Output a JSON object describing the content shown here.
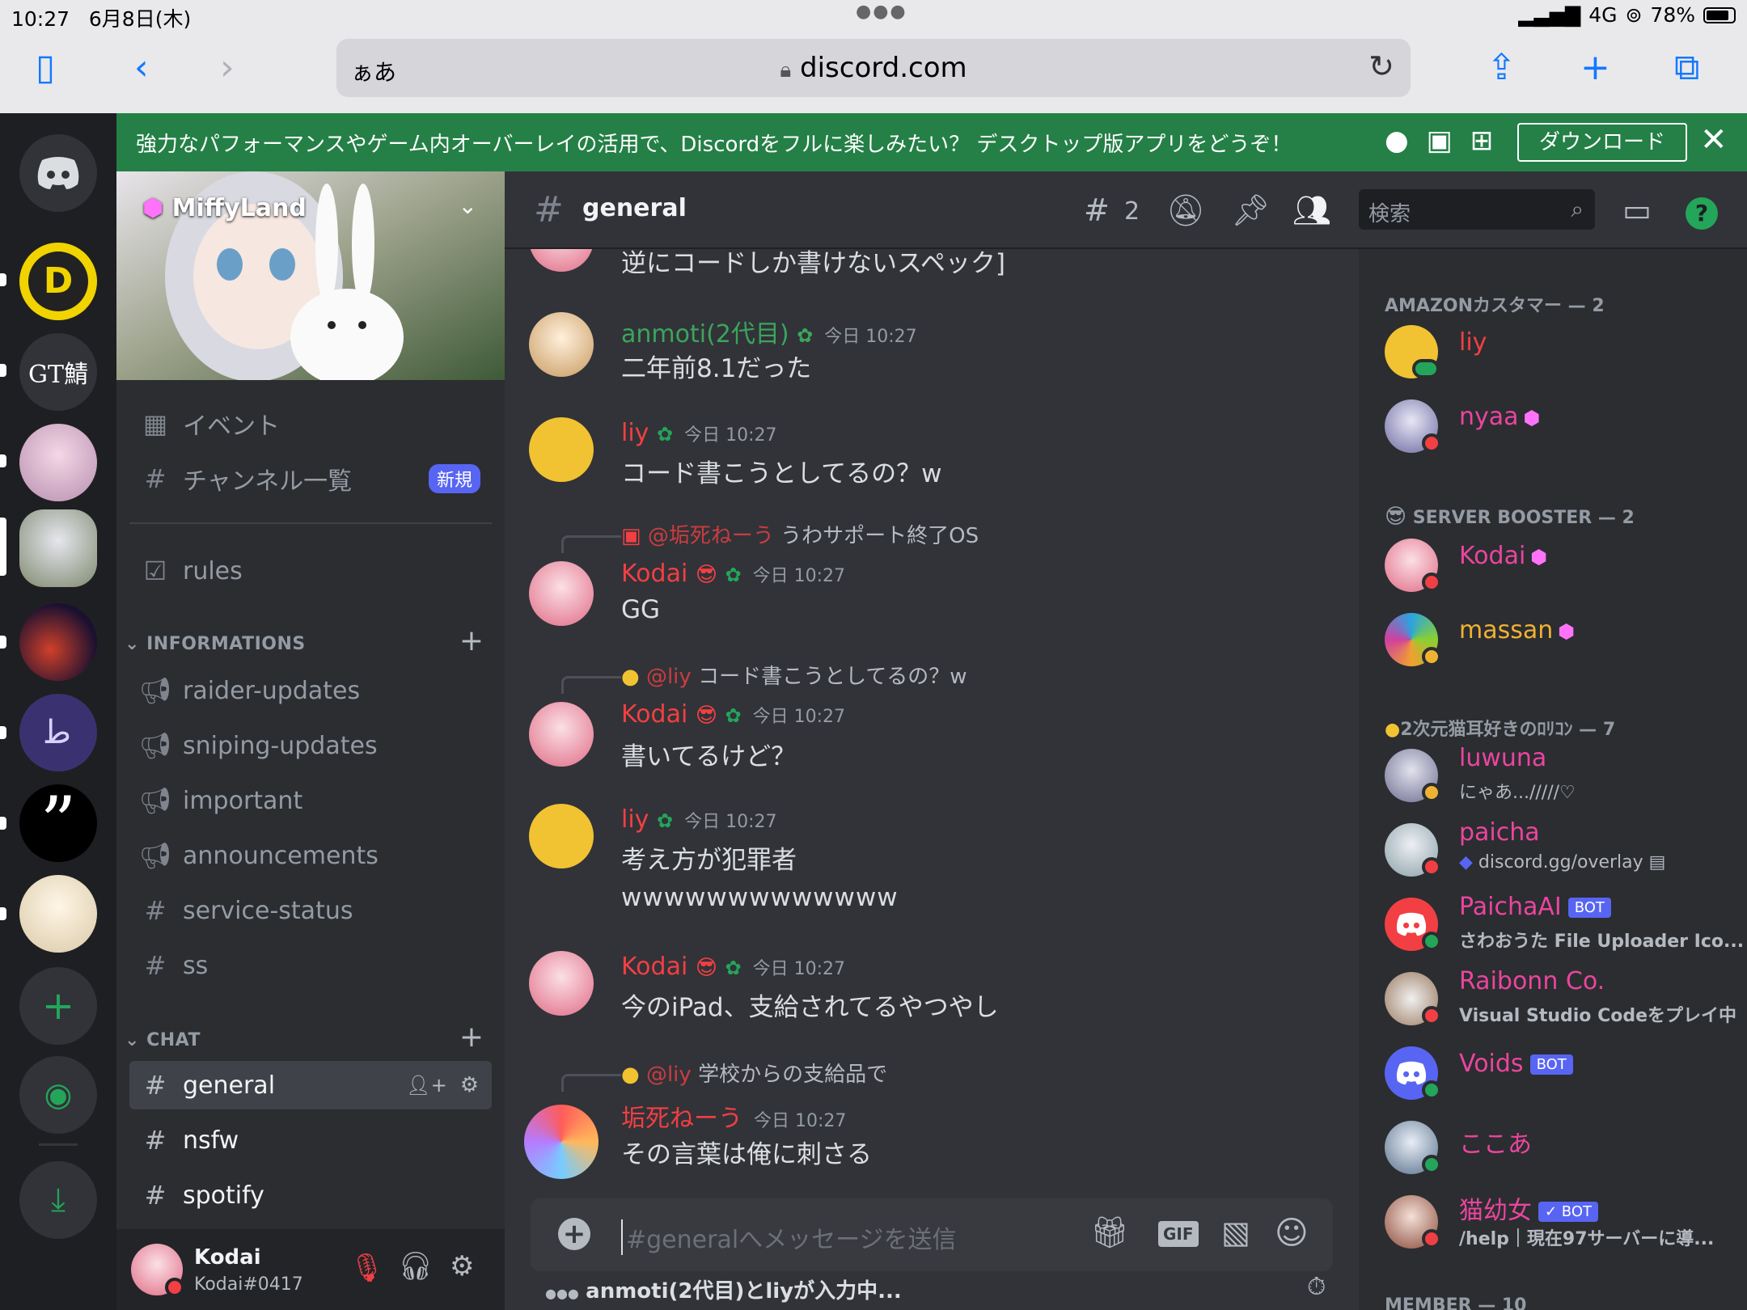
{
  "status_bar": {
    "time": "10:27",
    "date": "6月8日(木)",
    "network": "4G",
    "battery": "78%"
  },
  "browser": {
    "aa": "ぁあ",
    "domain": "discord.com"
  },
  "banner": {
    "text": "強力なパフォーマンスやゲーム内オーバーレイの活用で、Discordをフルに楽しみたい？ デスクトップ版アプリをどうぞ！",
    "download": "ダウンロード"
  },
  "guilds": {
    "gt_label": "GT鯖"
  },
  "server": {
    "name": "MiffyLand",
    "events": "イベント",
    "browse": "チャンネル一覧",
    "new_badge": "新規",
    "rules": "rules",
    "cat_info": "INFORMATIONS",
    "cat_chat": "CHAT",
    "info_channels": [
      "raider-updates",
      "sniping-updates",
      "important",
      "announcements",
      "service-status",
      "ss"
    ],
    "chat_channels": [
      "general",
      "nsfw",
      "spotify"
    ]
  },
  "user": {
    "name": "Kodai",
    "tag": "Kodai#0417"
  },
  "channel": {
    "name": "general",
    "threads_count": "2",
    "search_placeholder": "検索"
  },
  "messages": [
    {
      "text": "逆にコードしか書けないスペック]"
    },
    {
      "author": "anmoti(2代目)",
      "time": "今日 10:27",
      "text": "二年前8.1だった",
      "color": "#3ba55c"
    },
    {
      "author": "liy",
      "time": "今日 10:27",
      "text": "コード書こうとしてるの？w",
      "color": "#f23f43"
    },
    {
      "reply_to": "@垢死ねーう",
      "reply_text": "うわサポート終了OS",
      "author": "Kodai",
      "time": "今日 10:27",
      "text": "GG",
      "color": "#f23f43"
    },
    {
      "reply_to": "@liy",
      "reply_text": "コード書こうとしてるの？w",
      "author": "Kodai",
      "time": "今日 10:27",
      "text": "書いてるけど？",
      "color": "#f23f43"
    },
    {
      "author": "liy",
      "time": "今日 10:27",
      "text": "考え方が犯罪者",
      "text2": "wwwwwwwwwwwww",
      "color": "#f23f43"
    },
    {
      "author": "Kodai",
      "time": "今日 10:27",
      "text": "今のiPad、支給されてるやつやし",
      "color": "#f23f43"
    },
    {
      "reply_to": "@liy",
      "reply_text": "学校からの支給品で",
      "author": "垢死ねーう",
      "time": "今日 10:27",
      "text": "その言葉は俺に刺さる",
      "color": "#f23f43"
    }
  ],
  "composer": {
    "placeholder": "#generalへメッセージを送信",
    "gif": "GIF"
  },
  "typing": "anmoti(2代目)とliyが入力中...",
  "member_groups": [
    {
      "title": "AMAZONカスタマー — 2"
    },
    {
      "title": "SERVER BOOSTER — 2"
    },
    {
      "title": "2次元猫耳好きのﾛﾘｺﾝ — 7"
    },
    {
      "title": "MEMBER — 10"
    }
  ],
  "members": [
    {
      "name": "liy",
      "color": "#f23f43"
    },
    {
      "name": "nyaa",
      "color": "#eb459e"
    },
    {
      "name": "Kodai",
      "color": "#eb459e"
    },
    {
      "name": "massan",
      "color": "#f0b132"
    },
    {
      "name": "luwuna",
      "color": "#eb459e",
      "sub": "にゃあ.../////♡"
    },
    {
      "name": "paicha",
      "color": "#eb459e",
      "sub": "discord.gg/overlay"
    },
    {
      "name": "PaichaAI",
      "color": "#eb459e",
      "bot": "BOT",
      "sub": "さわおうた File Uploader Ico..."
    },
    {
      "name": "Raibonn Co.",
      "color": "#eb459e",
      "sub": "Visual Studio Codeをプレイ中"
    },
    {
      "name": "Voids",
      "color": "#eb459e",
      "bot": "BOT"
    },
    {
      "name": "ここあ",
      "color": "#eb459e"
    },
    {
      "name": "猫幼女",
      "color": "#eb459e",
      "bot": "✓ BOT",
      "sub": "/help｜現在97サーバーに導..."
    }
  ]
}
